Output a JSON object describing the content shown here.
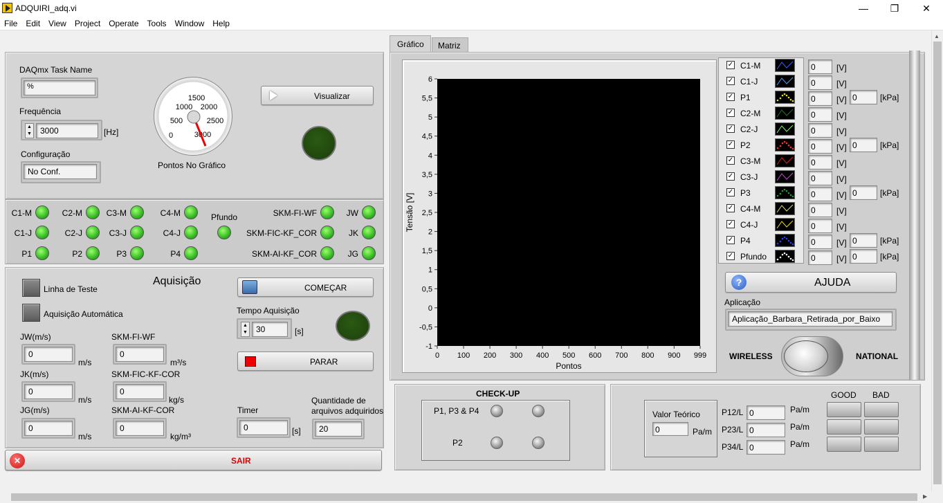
{
  "window": {
    "title": "ADQUIRI_adq.vi",
    "minimize": "—",
    "restore": "❐",
    "close": "✕"
  },
  "menu": [
    "File",
    "Edit",
    "View",
    "Project",
    "Operate",
    "Tools",
    "Window",
    "Help"
  ],
  "config": {
    "task_label": "DAQmx Task Name",
    "task_value": "%",
    "freq_label": "Frequência",
    "freq_value": "3000",
    "freq_unit": "[Hz]",
    "config_label": "Configuração",
    "config_value": "No Conf.",
    "gauge_label": "Pontos No Gráfico",
    "gauge_ticks": [
      "0",
      "500",
      "1000",
      "1500",
      "2000",
      "2500",
      "3000"
    ],
    "gauge_value": 3000,
    "visualizar_label": "Visualizar"
  },
  "leds": {
    "row1": [
      "C1-M",
      "C2-M",
      "C3-M",
      "C4-M",
      "Pfundo",
      "SKM-FI-WF",
      "JW"
    ],
    "row2": [
      "C1-J",
      "C2-J",
      "C3-J",
      "C4-J",
      "SKM-FIC-KF_COR",
      "JK"
    ],
    "row3": [
      "P1",
      "P2",
      "P3",
      "P4",
      "SKM-AI-KF_COR",
      "JG"
    ]
  },
  "aquisicao": {
    "title": "Aquisição",
    "linha_teste": "Linha de Teste",
    "aquisicao_auto": "Aquisição Automática",
    "comecar": "COMEÇAR",
    "tempo_label": "Tempo Aquisição",
    "tempo_value": "30",
    "tempo_unit": "[s]",
    "parar": "PARAR",
    "jw_label": "JW(m/s)",
    "jw_value": "0",
    "jw_unit": "m/s",
    "jk_label": "JK(m/s)",
    "jk_value": "0",
    "jk_unit": "m/s",
    "jg_label": "JG(m/s)",
    "jg_value": "0",
    "jg_unit": "m/s",
    "skm_fi_label": "SKM-FI-WF",
    "skm_fi_value": "0",
    "skm_fi_unit": "m³/s",
    "skm_fic_label": "SKM-FIC-KF-COR",
    "skm_fic_value": "0",
    "skm_fic_unit": "kg/s",
    "skm_ai_label": "SKM-AI-KF-COR",
    "skm_ai_value": "0",
    "skm_ai_unit": "kg/m³",
    "timer_label": "Timer",
    "timer_value": "0",
    "timer_unit": "[s]",
    "qtd_label1": "Quantidade de",
    "qtd_label2": "arquivos adquiridos",
    "qtd_value": "20"
  },
  "sair": "SAIR",
  "tabs": [
    "Gráfico",
    "Matriz"
  ],
  "chart_data": {
    "type": "line",
    "xlabel": "Pontos",
    "ylabel": "Tensão [V]",
    "xlim": [
      0,
      999
    ],
    "ylim": [
      -1,
      6
    ],
    "xticks": [
      "0",
      "100",
      "200",
      "300",
      "400",
      "500",
      "600",
      "700",
      "800",
      "900",
      "999"
    ],
    "yticks": [
      "6",
      "5,5",
      "5",
      "4,5",
      "4",
      "3,5",
      "3",
      "2,5",
      "2",
      "1,5",
      "1",
      "0,5",
      "0",
      "-0,5",
      "-1"
    ],
    "background": "#000000",
    "series": []
  },
  "legend": [
    {
      "name": "C1-M",
      "color": "#3a5fff",
      "style": "line",
      "v": "0",
      "u": "[V]"
    },
    {
      "name": "C1-J",
      "color": "#4aa0ff",
      "style": "line",
      "v": "0",
      "u": "[V]"
    },
    {
      "name": "P1",
      "color": "#e8e020",
      "style": "dots",
      "v": "0",
      "u": "[V]",
      "kpa": "0",
      "ku": "[kPa]"
    },
    {
      "name": "C2-M",
      "color": "#1f7a1f",
      "style": "line",
      "v": "0",
      "u": "[V]"
    },
    {
      "name": "C2-J",
      "color": "#7cff5a",
      "style": "line",
      "v": "0",
      "u": "[V]"
    },
    {
      "name": "P2",
      "color": "#ff3030",
      "style": "dots",
      "v": "0",
      "u": "[V]",
      "kpa": "0",
      "ku": "[kPa]"
    },
    {
      "name": "C3-M",
      "color": "#e02020",
      "style": "line",
      "v": "0",
      "u": "[V]"
    },
    {
      "name": "C3-J",
      "color": "#d040e0",
      "style": "line",
      "v": "0",
      "u": "[V]"
    },
    {
      "name": "P3",
      "color": "#2a9a2a",
      "style": "dots",
      "v": "0",
      "u": "[V]",
      "kpa": "0",
      "ku": "[kPa]"
    },
    {
      "name": "C4-M",
      "color": "#e8e060",
      "style": "line",
      "v": "0",
      "u": "[V]"
    },
    {
      "name": "C4-J",
      "color": "#f0e000",
      "style": "line",
      "v": "0",
      "u": "[V]"
    },
    {
      "name": "P4",
      "color": "#2a40ff",
      "style": "dots",
      "v": "0",
      "u": "[V]",
      "kpa": "0",
      "ku": "[kPa]"
    },
    {
      "name": "Pfundo",
      "color": "#ffffff",
      "style": "dots",
      "v": "0",
      "u": "[V]",
      "kpa": "0",
      "ku": "[kPa]"
    }
  ],
  "ajuda": "AJUDA",
  "aplicacao_label": "Aplicação",
  "aplicacao_value": "Aplicação_Barbara_Retirada_por_Baixo",
  "switch": {
    "left": "WIRELESS",
    "right": "NATIONAL"
  },
  "checkup": {
    "title": "CHECK-UP",
    "row1": "P1, P3 & P4",
    "row2": "P2"
  },
  "valor": {
    "label": "Valor Teórico",
    "value": "0",
    "unit": "Pa/m"
  },
  "pressures": [
    {
      "label": "P12/L",
      "value": "0",
      "unit": "Pa/m"
    },
    {
      "label": "P23/L",
      "value": "0",
      "unit": "Pa/m"
    },
    {
      "label": "P34/L",
      "value": "0",
      "unit": "Pa/m"
    }
  ],
  "goodbad": {
    "good": "GOOD",
    "bad": "BAD"
  }
}
